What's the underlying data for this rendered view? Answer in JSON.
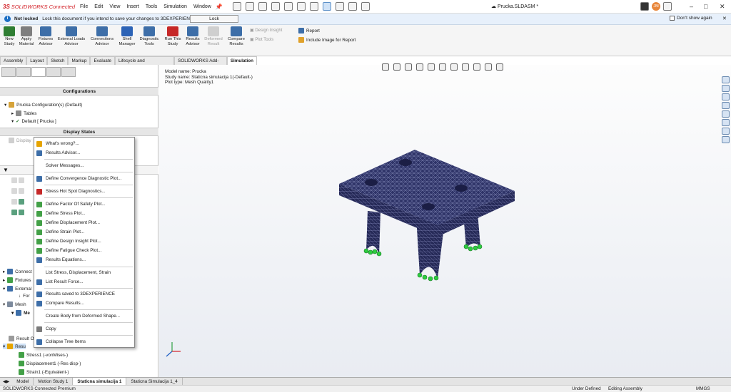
{
  "app": {
    "brand_ds": "3S",
    "brand_name": "SOLIDWORKS Connected",
    "doc_name": "Prucka.SLDASM *",
    "user_initials": "JM"
  },
  "menu": [
    "File",
    "Edit",
    "View",
    "Insert",
    "Tools",
    "Simulation",
    "Window"
  ],
  "lock_bar": {
    "status": "Not locked",
    "message": "Lock this document if you intend to save your changes to 3DEXPERIENCE.",
    "button": "Lock",
    "dont_show": "Don't show again"
  },
  "commands": [
    {
      "label": "New Study",
      "color": "#2e7d32"
    },
    {
      "label": "Apply Material",
      "color": "#6a6a6a"
    },
    {
      "label": "Fixtures Advisor",
      "color": "#3d6ea8"
    },
    {
      "label": "External Loads Advisor",
      "color": "#3d6ea8"
    },
    {
      "label": "Connections Advisor",
      "color": "#3d6ea8"
    },
    {
      "label": "Shell Manager",
      "color": "#2c63b6"
    },
    {
      "label": "Diagnostic Tools",
      "color": "#3d6ea8"
    },
    {
      "label": "Run This Study",
      "color": "#c62828"
    },
    {
      "label": "Results Advisor",
      "color": "#3d6ea8"
    },
    {
      "label": "Deformed Result",
      "color": "#bdbdbd"
    },
    {
      "label": "Compare Results",
      "color": "#3d6ea8"
    }
  ],
  "commands_small": [
    "Design Insight",
    "Plot Tools"
  ],
  "report": {
    "report": "Report",
    "include_image": "Include Image for Report"
  },
  "tabs": [
    "Assembly",
    "Layout",
    "Sketch",
    "Markup",
    "Evaluate",
    "Lifecycle and Collaboration",
    "SOLIDWORKS Add-Ins",
    "Simulation"
  ],
  "config_panel": {
    "header": "Configurations",
    "root": "Prucka Configuration(s)  (Default)",
    "tables": "Tables",
    "default": "Default [ Prucka ]",
    "display_states": "Display States",
    "display_item": "Display"
  },
  "tree": {
    "connections": "Connect",
    "fixtures": "Fixtures",
    "external": "External",
    "force": "For",
    "mesh": "Mesh",
    "mesh_sub": "Me",
    "result_options": "Result O",
    "results": "Resu",
    "results_items": [
      "Stress1 (-vonMises-)",
      "Displacement1 (-Res disp-)",
      "Strain1 (-Equivalent-)"
    ]
  },
  "context_menu": [
    {
      "label": "What's wrong?...",
      "icon": "warning-icon",
      "color": "#e6a400"
    },
    {
      "label": "Results Advisor...",
      "icon": "results-advisor-icon",
      "color": "#3d6ea8"
    },
    {
      "label": "Solver Messages...",
      "icon": "",
      "color": ""
    },
    {
      "label": "Define Convergence Diagnostic Plot...",
      "icon": "convergence-icon",
      "color": "#3d6ea8"
    },
    {
      "label": "Stress Hot Spot Diagnostics...",
      "icon": "hotspot-icon",
      "color": "#c62828"
    },
    {
      "label": "Define Factor Of Safety Plot...",
      "icon": "fos-plot-icon",
      "color": "#43a047"
    },
    {
      "label": "Define Stress Plot...",
      "icon": "stress-plot-icon",
      "color": "#43a047"
    },
    {
      "label": "Define Displacement Plot...",
      "icon": "displacement-plot-icon",
      "color": "#43a047"
    },
    {
      "label": "Define Strain Plot...",
      "icon": "strain-plot-icon",
      "color": "#43a047"
    },
    {
      "label": "Define Design Insight Plot...",
      "icon": "design-insight-icon",
      "color": "#43a047"
    },
    {
      "label": "Define Fatigue Check Plot...",
      "icon": "fatigue-plot-icon",
      "color": "#43a047"
    },
    {
      "label": "Results Equations...",
      "icon": "equations-icon",
      "color": "#3d6ea8"
    },
    {
      "label": "List Stress, Displacement, Strain",
      "icon": "",
      "color": ""
    },
    {
      "label": "List Result Force...",
      "icon": "list-force-icon",
      "color": "#3d6ea8"
    },
    {
      "label": "Results saved to 3DEXPERIENCE",
      "icon": "saved-3dx-icon",
      "color": "#3d6ea8"
    },
    {
      "label": "Compare Results...",
      "icon": "compare-icon",
      "color": "#3d6ea8"
    },
    {
      "label": "Create Body from Deformed Shape...",
      "icon": "",
      "color": ""
    },
    {
      "label": "Copy",
      "icon": "copy-icon",
      "color": "#7a7a7a"
    },
    {
      "label": "Collapse Tree Items",
      "icon": "collapse-icon",
      "color": "#3d6ea8"
    }
  ],
  "viewport": {
    "model_name": "Model name: Prucka",
    "study_name": "Study name: Staticna simulacija 1(-Default-)",
    "plot_type": "Plot type: Mesh Quality1"
  },
  "bottom_tabs": [
    "Model",
    "Motion Study 1",
    "Staticna simulacija 1",
    "Staticna Simulacija 1_4"
  ],
  "bottom_hidden_tab": "Model | Staticna simulacija 1",
  "status": {
    "product": "SOLIDWORKS Connected Premium",
    "state": "Under Defined",
    "mode": "Editing Assembly",
    "units": "MMGS"
  }
}
